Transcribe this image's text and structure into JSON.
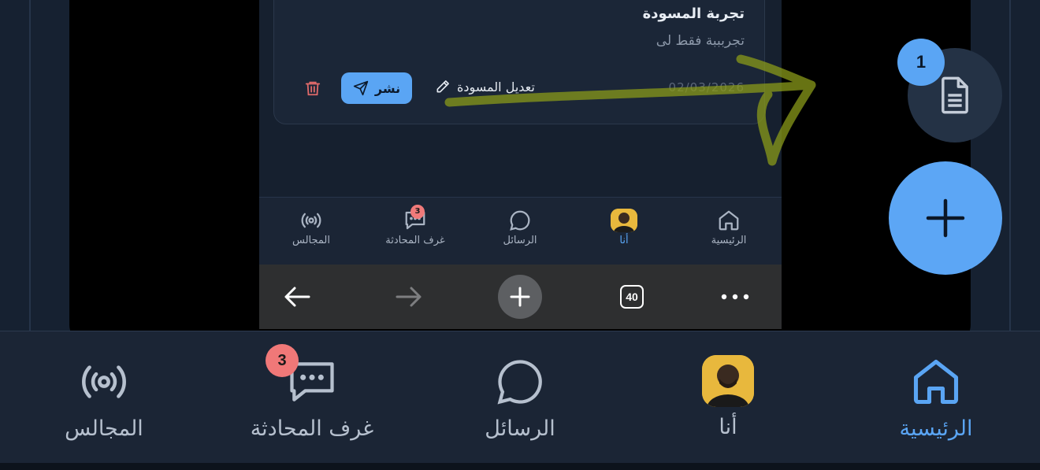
{
  "draft_card": {
    "title": "تجربة المسودة",
    "body": "تجربببة فقط لى",
    "date": "02/03/2026",
    "edit_label": "تعديل المسودة",
    "publish_label": "نشر"
  },
  "inner_nav": {
    "home": "الرئيسية",
    "me": "أنا",
    "messages": "الرسائل",
    "chat_rooms": "غرف المحادثة",
    "chat_rooms_badge": "3",
    "councils": "المجالس"
  },
  "browser": {
    "tab_count": "40"
  },
  "fab": {
    "draft_count": "1"
  },
  "main_nav": {
    "home": "الرئيسية",
    "me": "أنا",
    "messages": "الرسائل",
    "chat_rooms": "غرف المحادثة",
    "chat_rooms_badge": "3",
    "councils": "المجالس"
  },
  "colors": {
    "accent": "#5aa5f4",
    "badge": "#f07878",
    "background": "#1b2535",
    "scribble": "#8a9a1a"
  }
}
